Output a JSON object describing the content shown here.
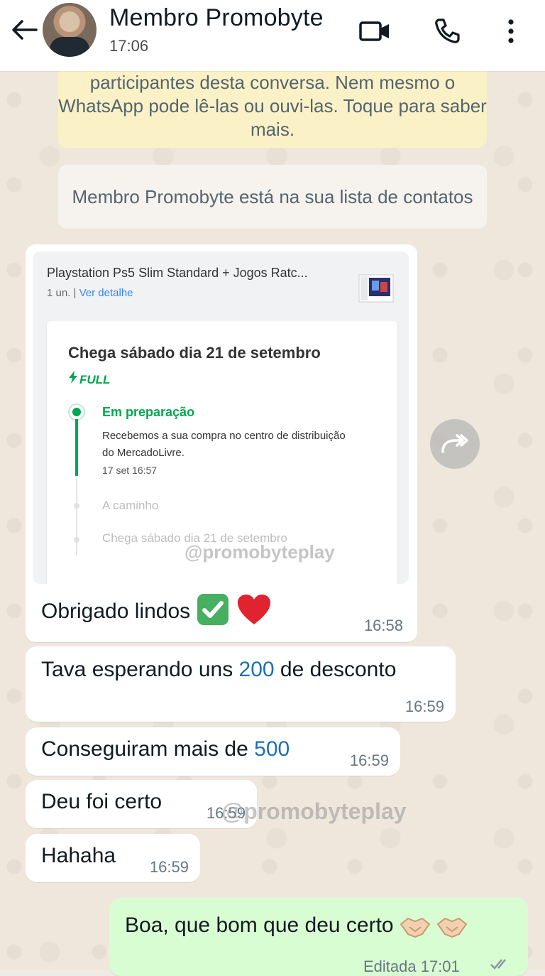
{
  "header": {
    "contact_name": "Membro Promobyte",
    "last_seen": "17:06"
  },
  "notices": {
    "encryption": "participantes desta conversa. Nem mesmo o WhatsApp pode lê-las ou ouvi-las. Toque para saber mais.",
    "contact": "Membro Promobyte está na sua lista de contatos"
  },
  "order": {
    "product_title": "Playstation Ps5 Slim Standard + Jogos Ratc...",
    "quantity": "1 un.",
    "separator": " | ",
    "detail_link": "Ver detalhe",
    "arrival": "Chega sábado dia 21 de setembro",
    "badge": "FULL",
    "step1_title": "Em preparação",
    "step1_desc": "Recebemos a sua compra no centro de distribuição do MercadoLivre.",
    "step1_time": "17 set 16:57",
    "step2_title": "A caminho",
    "step3_title": "Chega sábado dia 21 de setembro"
  },
  "watermark": "@promobyteplay",
  "messages": {
    "img_caption": "Obrigado lindos",
    "img_time": "16:58",
    "m1_pre": "Tava esperando uns ",
    "m1_num": "200",
    "m1_post": " de desconto",
    "m1_time": "16:59",
    "m2_pre": "Conseguiram mais de ",
    "m2_num": "500",
    "m2_time": "16:59",
    "m3": "Deu foi certo",
    "m3_time": "16:59",
    "m4": "Hahaha",
    "m4_time": "16:59",
    "out_text": "Boa, que bom que deu certo",
    "out_time": "Editada 17:01"
  },
  "colors": {
    "outgoing_bubble": "#d9fdd3",
    "mercadolivre_green": "#00a650",
    "link_blue": "#3483fa"
  }
}
